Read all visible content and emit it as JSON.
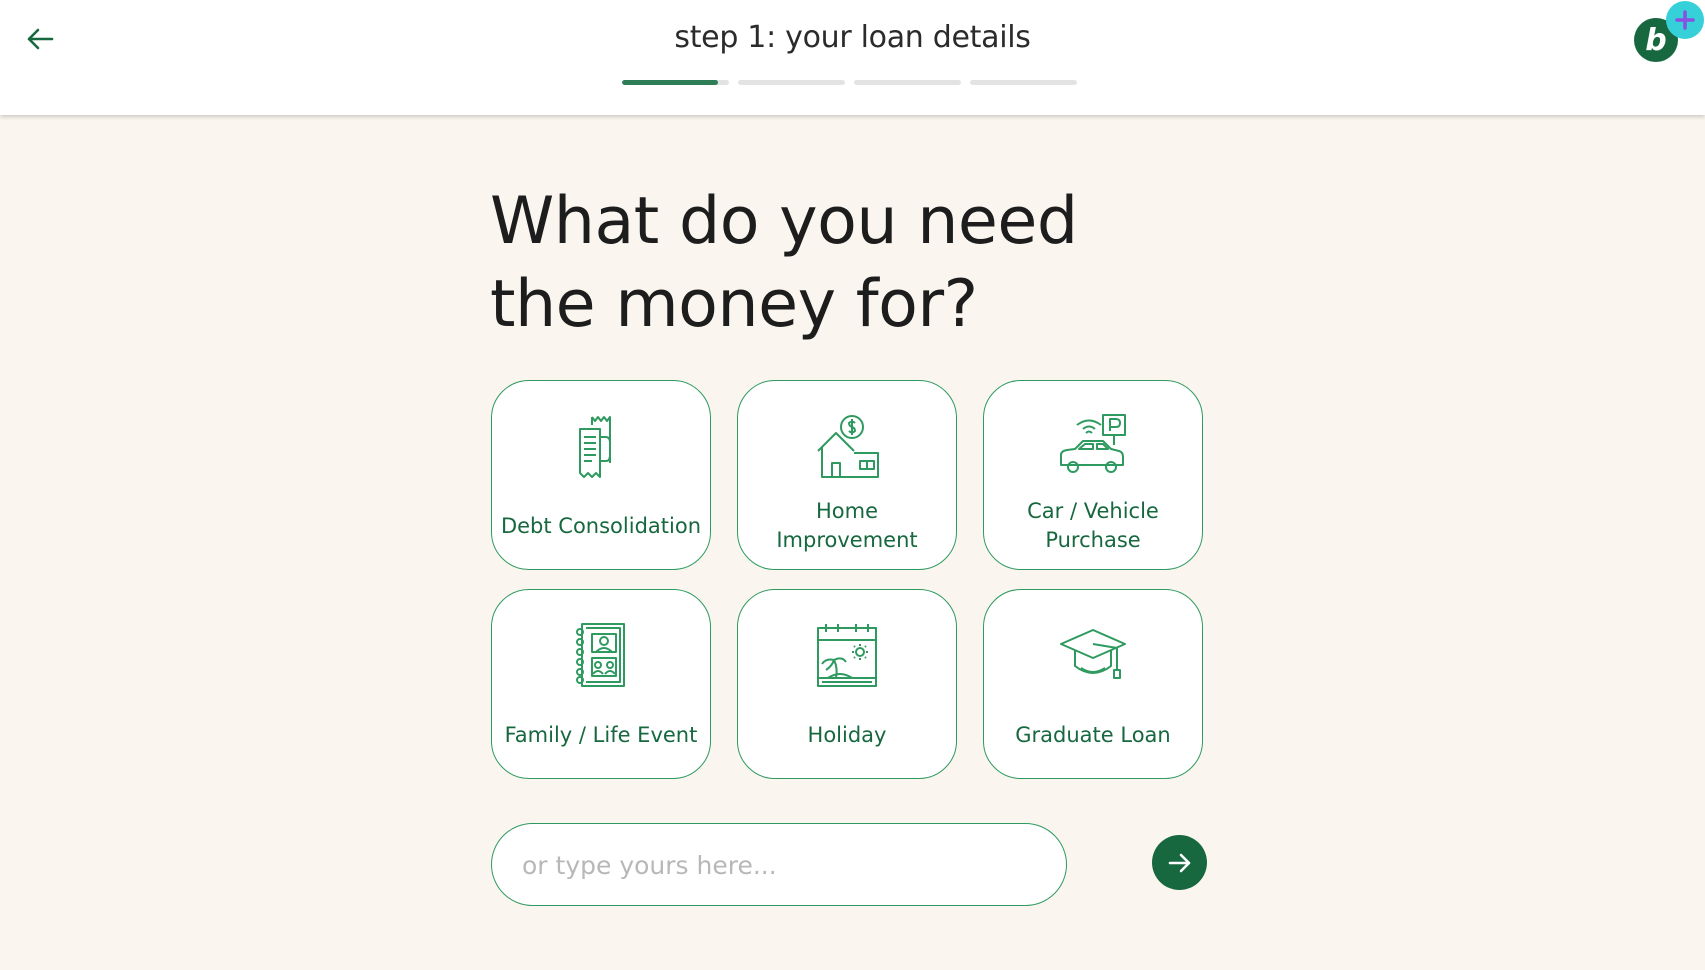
{
  "header": {
    "title": "step 1: your loan details",
    "back_icon": "arrow-left-icon",
    "progress": [
      1,
      0,
      0,
      0
    ],
    "active_step_fill": 0.9,
    "brand_letter": "b",
    "accent_color": "#17683f",
    "brand_plus_color": "#35d0d8"
  },
  "main": {
    "heading_line1": "What do you need",
    "heading_line2": "the money for?",
    "options": [
      {
        "label": "Debt Consolidation",
        "icon": "receipt-icon"
      },
      {
        "label": "Home Improvement",
        "icon": "house-dollar-icon"
      },
      {
        "label": "Car / Vehicle Purchase",
        "icon": "car-parking-icon"
      },
      {
        "label": "Family / Life Event",
        "icon": "photo-album-icon"
      },
      {
        "label": "Holiday",
        "icon": "calendar-beach-icon"
      },
      {
        "label": "Graduate Loan",
        "icon": "graduation-cap-icon"
      }
    ],
    "input_placeholder": "or type yours here...",
    "input_value": "",
    "next_icon": "arrow-right-icon"
  }
}
